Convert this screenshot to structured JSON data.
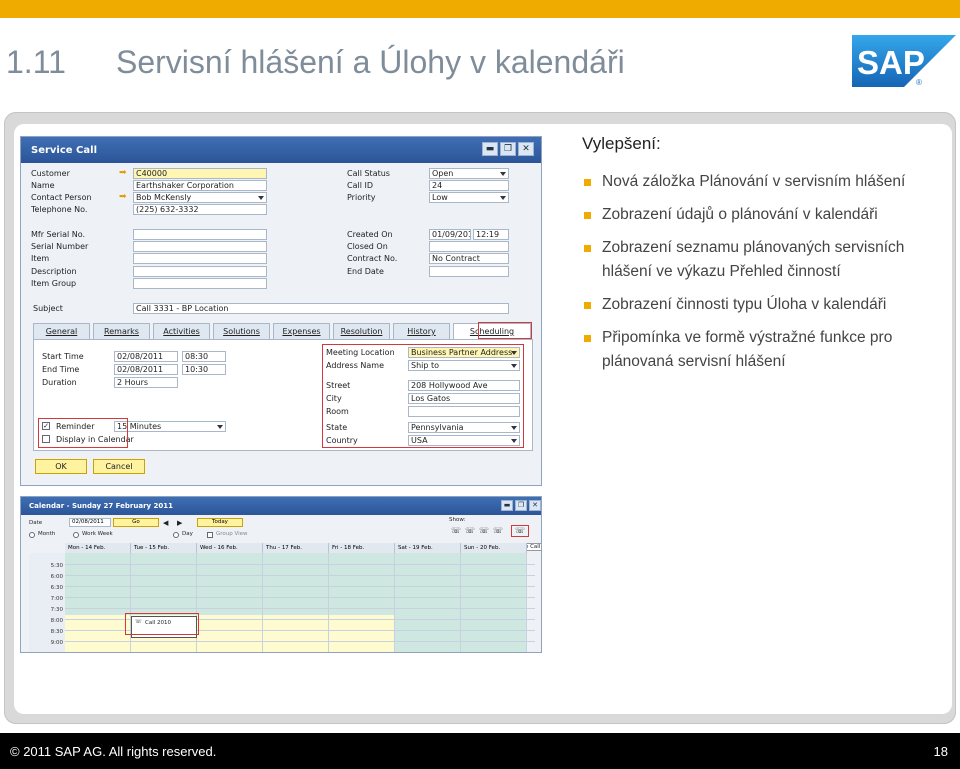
{
  "slide": {
    "number_prefix": "1.11",
    "title": "Servisní hlášení a Úlohy v kalendáři",
    "logo_text": "SAP",
    "logo_mark": "®",
    "heading": "Vylepšení:",
    "bullets": [
      "Nová záložka Plánování v servisním hlášení",
      "Zobrazení údajů o plánování v kalendáři",
      "Zobrazení seznamu plánovaných servisních hlášení ve  výkazu Přehled činností",
      "Zobrazení činnosti typu Úloha v kalendáři",
      "Připomínka ve formě  výstražné funkce pro plánovaná servisní hlášení"
    ],
    "footer_copyright": "©  2011 SAP AG. All rights reserved.",
    "page_number": "18",
    "colors": {
      "accent": "#f0ab00",
      "title": "#7f8c99",
      "sap_blue": "#1d6fc2"
    }
  },
  "service_call": {
    "title": "Service Call",
    "window_buttons": [
      "▬",
      "❐",
      "✕"
    ],
    "left_fields": [
      {
        "label": "Customer",
        "value": "C40000"
      },
      {
        "label": "Name",
        "value": "Earthshaker Corporation"
      },
      {
        "label": "Contact Person",
        "value": "Bob McKensly"
      },
      {
        "label": "Telephone No.",
        "value": "(225) 632-3332"
      }
    ],
    "left_fields2": [
      {
        "label": "Mfr Serial No.",
        "value": ""
      },
      {
        "label": "Serial Number",
        "value": ""
      },
      {
        "label": "Item",
        "value": ""
      },
      {
        "label": "Description",
        "value": ""
      },
      {
        "label": "Item Group",
        "value": ""
      }
    ],
    "right_fields": [
      {
        "label": "Call Status",
        "value": "Open"
      },
      {
        "label": "Call ID",
        "value": "24"
      },
      {
        "label": "Priority",
        "value": "Low"
      }
    ],
    "right_fields2": [
      {
        "label": "Created On",
        "value": "01/09/2011",
        "time": "12:19"
      },
      {
        "label": "Closed On",
        "value": ""
      },
      {
        "label": "Contract No.",
        "value": "No Contract"
      },
      {
        "label": "End Date",
        "value": ""
      }
    ],
    "subject_label": "Subject",
    "subject_value": "Call 3331 - BP Location",
    "tabs": [
      "General",
      "Remarks",
      "Activities",
      "Solutions",
      "Expenses",
      "Resolution",
      "History",
      "Scheduling"
    ],
    "schedule": {
      "start_time_label": "Start Time",
      "start_date": "02/08/2011",
      "start_time": "08:30",
      "end_time_label": "End Time",
      "end_date": "02/08/2011",
      "end_time": "10:30",
      "duration_label": "Duration",
      "duration": "2 Hours",
      "reminder_label": "Reminder",
      "reminder_value": "15 Minutes",
      "display_label": "Display in Calendar"
    },
    "location": [
      {
        "label": "Meeting Location",
        "value": "Business Partner Address"
      },
      {
        "label": "Address Name",
        "value": "Ship to"
      },
      {
        "label": "Street",
        "value": "208 Hollywood Ave"
      },
      {
        "label": "City",
        "value": "Los Gatos"
      },
      {
        "label": "Room",
        "value": ""
      },
      {
        "label": "State",
        "value": "Pennsylvania"
      },
      {
        "label": "Country",
        "value": "USA"
      }
    ],
    "ok_label": "OK",
    "cancel_label": "Cancel"
  },
  "calendar": {
    "title": "Calendar - Sunday 27 February 2011",
    "date_label": "Date",
    "date_value": "02/08/2011",
    "go_label": "Go",
    "today_label": "Today",
    "show_label": "Show:",
    "service_call_label": "Service Call",
    "views": [
      "Month",
      "Work Week",
      "Day",
      "Group View"
    ],
    "days": [
      "Mon - 14 Feb.",
      "Tue - 15 Feb.",
      "Wed - 16 Feb.",
      "Thu - 17 Feb.",
      "Fri - 18 Feb.",
      "Sat - 19 Feb.",
      "Sun - 20 Feb."
    ],
    "times": [
      "5:30",
      "6:00",
      "6:30",
      "7:00",
      "7:30",
      "8:00",
      "8:30",
      "9:00"
    ],
    "event_label": "Call 2010"
  }
}
